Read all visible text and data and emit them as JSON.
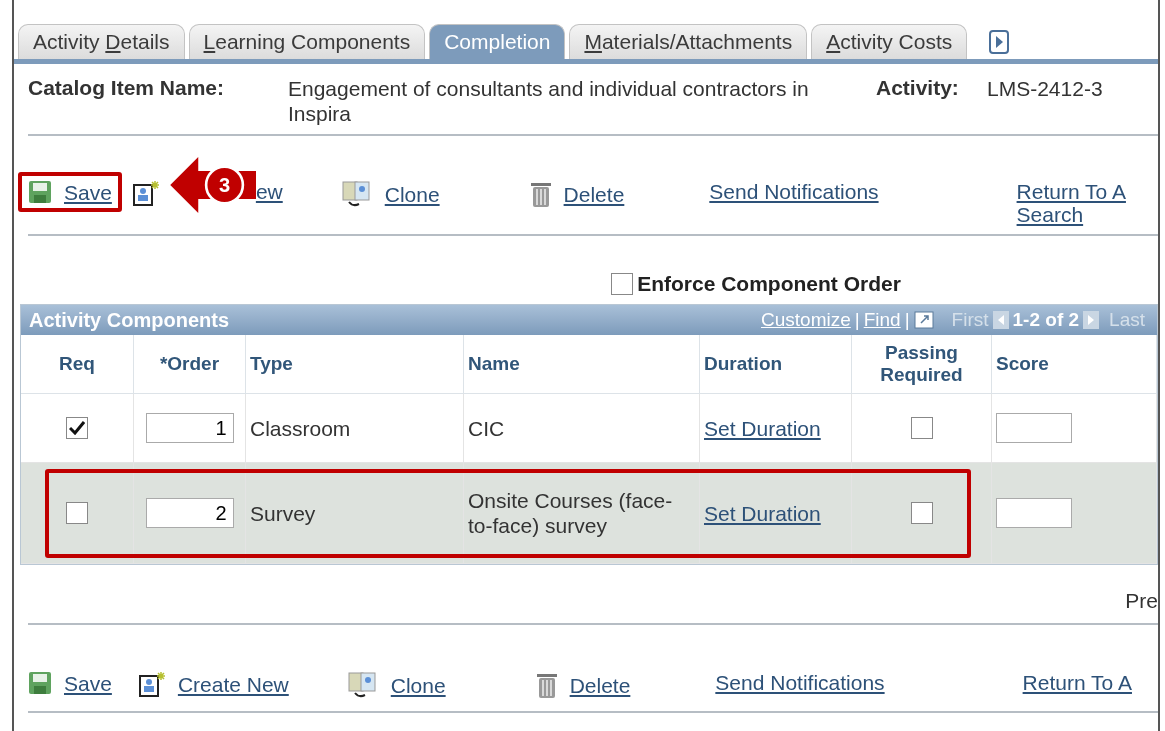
{
  "tabs": [
    {
      "label_start": "Activity ",
      "access_key": "D",
      "label_end": "etails",
      "selected": false
    },
    {
      "access_key": "L",
      "label_end": "earning Components",
      "selected": false
    },
    {
      "label_end": "Completion",
      "selected": true
    },
    {
      "access_key": "M",
      "label_end": "aterials/Attachments",
      "selected": false
    },
    {
      "access_key": "A",
      "label_end": "ctivity Costs",
      "selected": false
    }
  ],
  "header": {
    "catalog_label": "Catalog Item Name:",
    "catalog_value": "Engagement of consultants and individual contractors in Inspira",
    "activity_label": "Activity:",
    "activity_value": "LMS-2412-3"
  },
  "top_toolbar": [
    {
      "kind": "save",
      "label": "Save",
      "highlighted": true
    },
    {
      "kind": "create",
      "label": "ew",
      "highlighted": false
    },
    {
      "kind": "clone",
      "label": "Clone",
      "highlighted": false
    },
    {
      "kind": "delete",
      "label": "Delete",
      "highlighted": false
    },
    {
      "kind": "notify",
      "label": "Send Notifications",
      "highlighted": false
    },
    {
      "kind": "return",
      "label": "Return To A Search",
      "highlighted": false
    }
  ],
  "callout": {
    "step": "3"
  },
  "enforce_order": {
    "label": "Enforce Component Order",
    "checked": false
  },
  "grid": {
    "title": "Activity Components",
    "customize": "Customize",
    "separator": "|",
    "find": "Find",
    "first": "First",
    "range": "1-2 of 2",
    "last": "Last",
    "columns": [
      "Req",
      "*Order",
      "Type",
      "Name",
      "Duration",
      "Passing Required",
      "Score"
    ],
    "rows": [
      {
        "required": true,
        "order": "1",
        "type": "Classroom",
        "name": "CIC",
        "duration": "Set Duration",
        "passing": false,
        "highlighted": false
      },
      {
        "required": false,
        "order": "2",
        "type": "Survey",
        "name": "Onsite Courses (face-to-face) survey",
        "duration": "Set Duration",
        "passing": false,
        "highlighted": true
      }
    ]
  },
  "pager_text": "Pre",
  "bottom_toolbar": [
    {
      "kind": "save",
      "label": "Save",
      "highlighted": false
    },
    {
      "kind": "create",
      "label": "Create New",
      "highlighted": false
    },
    {
      "kind": "clone",
      "label": "Clone",
      "highlighted": false
    },
    {
      "kind": "delete",
      "label": "Delete",
      "highlighted": false
    },
    {
      "kind": "notify",
      "label": "Send Notifications",
      "highlighted": false
    },
    {
      "kind": "return",
      "label": "Return To A",
      "highlighted": false
    }
  ]
}
